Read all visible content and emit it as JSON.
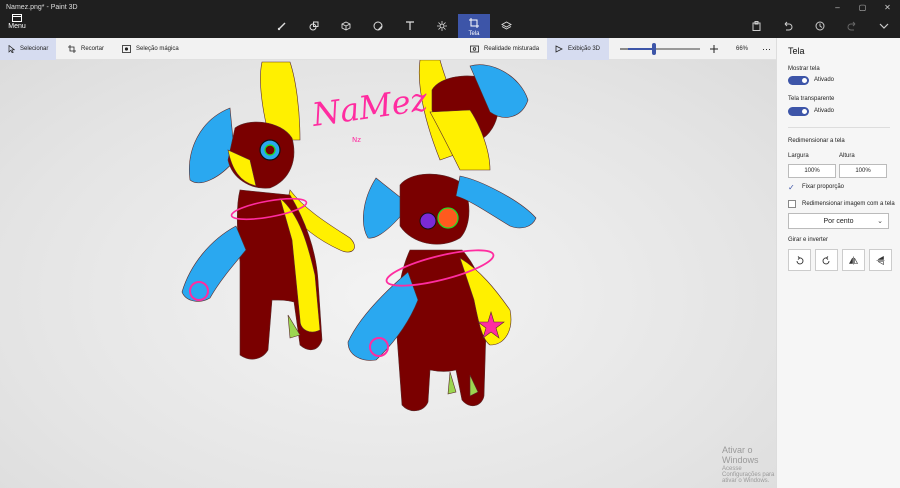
{
  "window": {
    "title": "Namez.png* - Paint 3D",
    "menu_label": "Menu"
  },
  "main_tools": [
    {
      "name": "brushes",
      "icon": "brush-icon"
    },
    {
      "name": "2d-shapes",
      "icon": "shapes-2d-icon"
    },
    {
      "name": "3d-shapes",
      "icon": "cube-icon"
    },
    {
      "name": "stickers",
      "icon": "sticker-icon"
    },
    {
      "name": "text",
      "icon": "text-icon"
    },
    {
      "name": "effects",
      "icon": "effects-icon"
    },
    {
      "name": "canvas",
      "icon": "canvas-icon",
      "label": "Tela",
      "active": true
    },
    {
      "name": "3d-library",
      "icon": "library-icon"
    }
  ],
  "toolbar": {
    "select": "Selecionar",
    "crop": "Recortar",
    "magic_select": "Seleção mágica",
    "mixed_reality": "Realidade misturada",
    "view_3d": "Exibição 3D",
    "zoom_value": "66%",
    "zoom_fraction": 0.36
  },
  "canvas": {
    "drawing_text": "NaMez",
    "drawing_subtext": "Nz"
  },
  "panel": {
    "title": "Tela",
    "show_canvas_label": "Mostrar tela",
    "show_canvas_state": "Ativado",
    "transparent_label": "Tela transparente",
    "transparent_state": "Ativado",
    "resize_label": "Redimensionar a tela",
    "width_label": "Largura",
    "height_label": "Altura",
    "width_value": "100%",
    "height_value": "100%",
    "lock_ratio": "Fixar proporção",
    "resize_image": "Redimensionar imagem com a tela",
    "unit": "Por cento",
    "rotate_label": "Girar e inverter"
  },
  "watermark": {
    "line1": "Ativar o Windows",
    "line2": "Acesse Configurações para ativar o Windows."
  },
  "colors": {
    "accent": "#3d55a8",
    "titlebar": "#1f1f1f",
    "maroon": "#7a0000",
    "yellow": "#fff000",
    "blue": "#2aa8f0",
    "magenta": "#ff2ca0"
  }
}
